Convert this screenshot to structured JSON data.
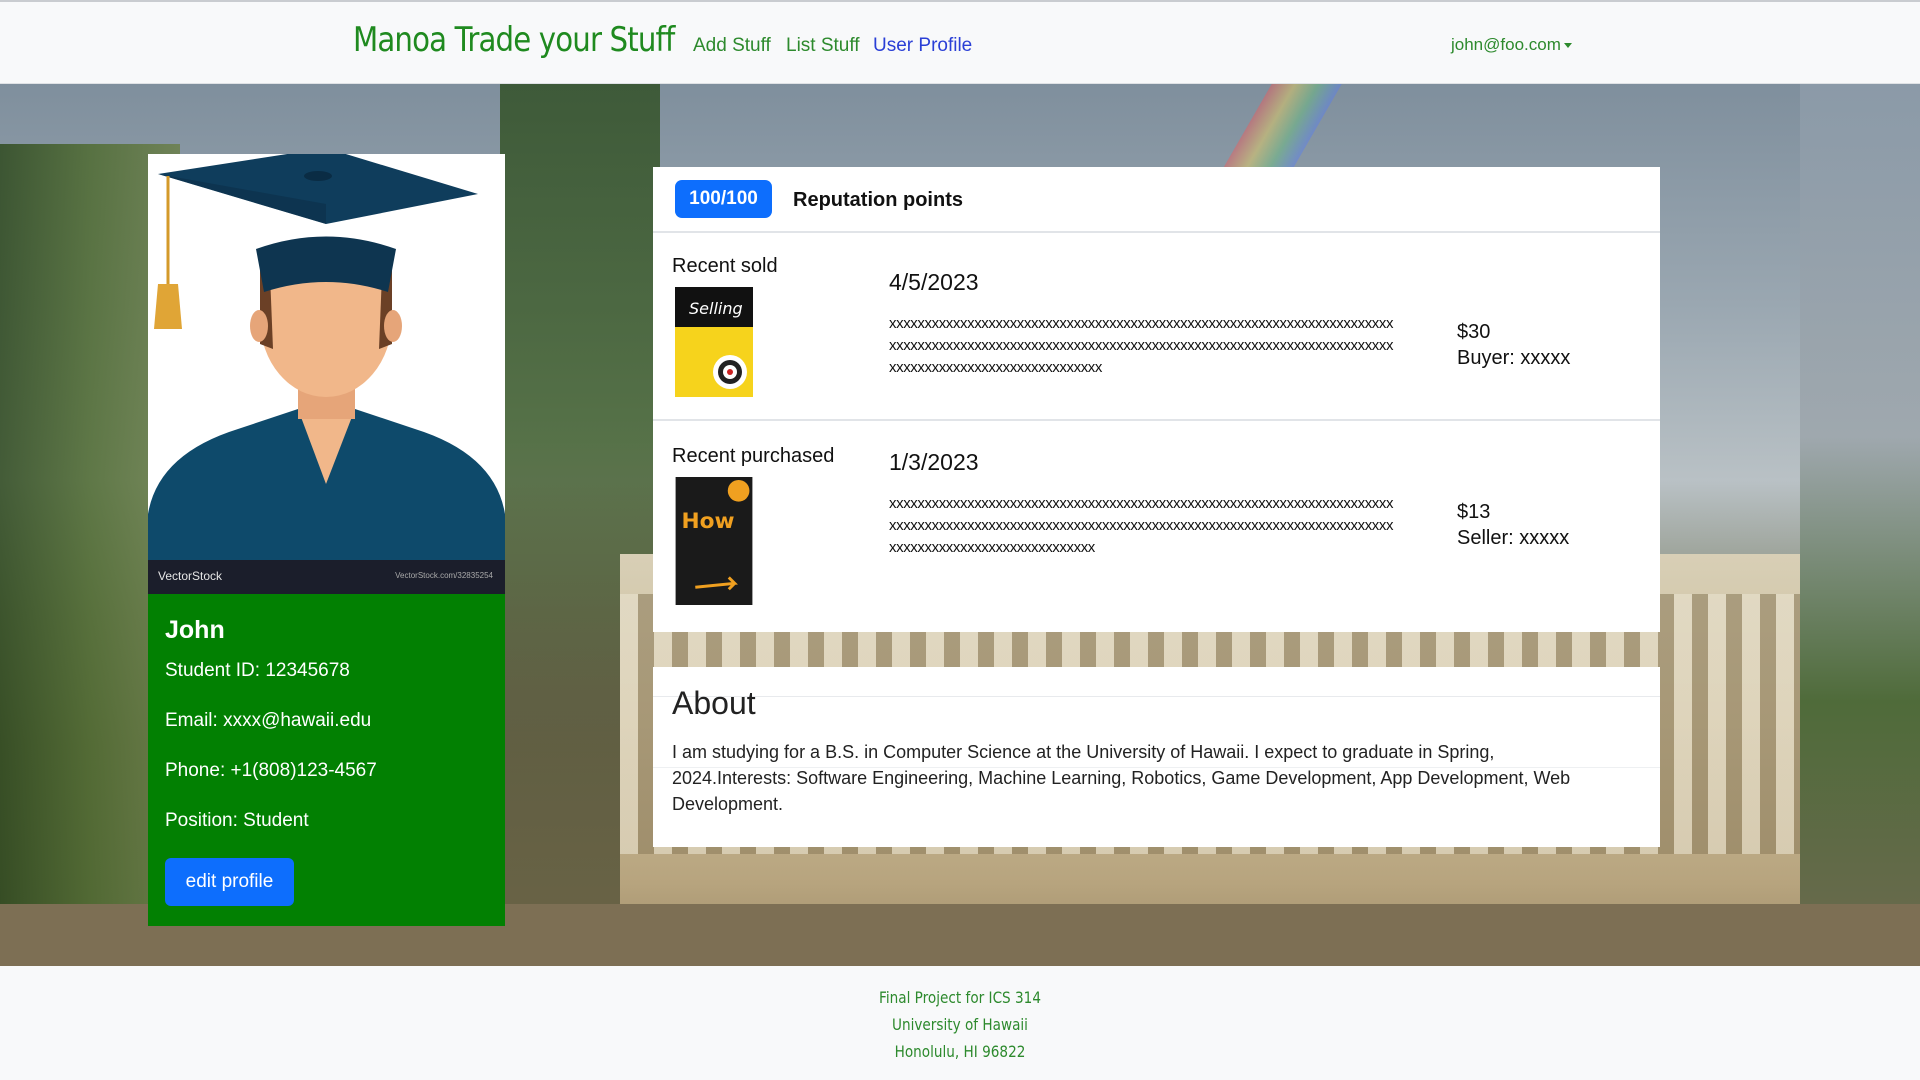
{
  "navbar": {
    "brand": "Manoa Trade your Stuff",
    "links": [
      "Add Stuff",
      "List Stuff",
      "User Profile"
    ],
    "user_menu": "john@foo.com"
  },
  "profile": {
    "avatar_watermark_left": "VectorStock",
    "avatar_watermark_right": "VectorStock.com/32835254",
    "name": "John",
    "student_id": "Student ID: 12345678",
    "email": "Email: xxxx@hawaii.edu",
    "phone": "Phone: +1(808)123-4567",
    "position": "Position: Student",
    "edit_label": "edit profile"
  },
  "reputation": {
    "badge": "100/100",
    "label": "Reputation points"
  },
  "transactions": [
    {
      "title": "Recent sold",
      "book_title": "Selling For Dummies",
      "date": "4/5/2023",
      "description": "xxxxxxxxxxxxxxxxxxxxxxxxxxxxxxxxxxxxxxxxxxxxxxxxxxxxxxxxxxxxxxxxxxxxxxxxxxxxxxxxxxxxxxxxxxxxxxxxxxxxxxxxxxxxxxxxxxxxxxxxxxxxxxxxxxxxxxxxxxxxxxxxxxxxxxxxxxxxxxxxxxxxxxxxxxxx",
      "price": "$30",
      "party": "Buyer: xxxxx"
    },
    {
      "title": "Recent purchased",
      "book_title": "How to Sell on Amazon FBA",
      "date": "1/3/2023",
      "description": "xxxxxxxxxxxxxxxxxxxxxxxxxxxxxxxxxxxxxxxxxxxxxxxxxxxxxxxxxxxxxxxxxxxxxxxxxxxxxxxxxxxxxxxxxxxxxxxxxxxxxxxxxxxxxxxxxxxxxxxxxxxxxxxxxxxxxxxxxxxxxxxxxxxxxxxxxxxxxxxxxxxxxxxxxxx",
      "price": "$13",
      "party": "Seller: xxxxx"
    }
  ],
  "about": {
    "title": "About",
    "text": "I am studying for a B.S. in Computer Science at the University of Hawaii. I expect to graduate in Spring, 2024.Interests: Software Engineering, Machine Learning, Robotics, Game Development, App Development, Web Development."
  },
  "footer": {
    "lines": [
      "Final Project for ICS 314",
      "University of Hawaii",
      "Honolulu, HI 96822"
    ]
  },
  "colors": {
    "brand_green": "#1f8a1f",
    "profile_green": "#028002",
    "primary_blue": "#0d6efd",
    "active_link": "#2a3fd6"
  }
}
